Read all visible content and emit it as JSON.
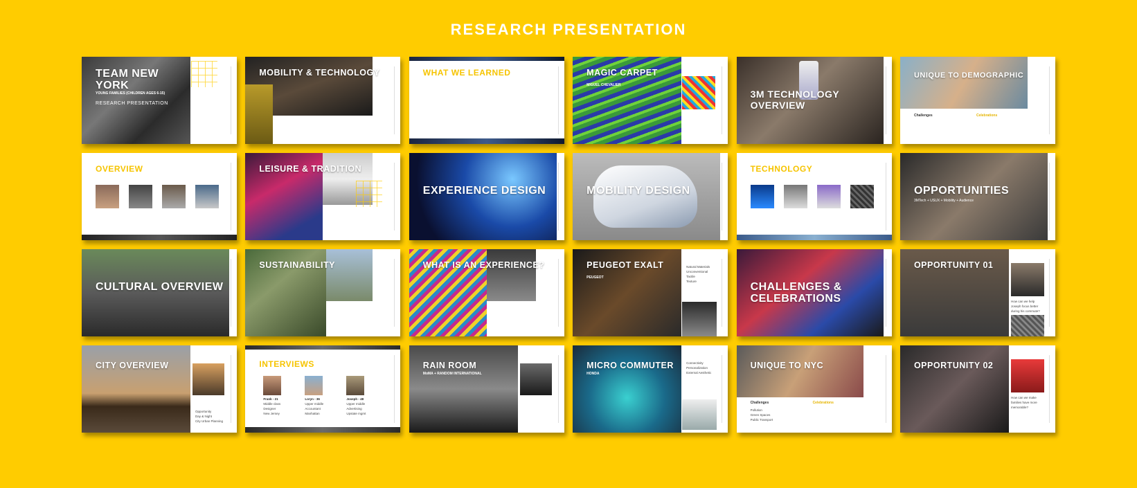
{
  "page": {
    "title": "RESEARCH PRESENTATION"
  },
  "slides": [
    {
      "title": "TEAM NEW YORK",
      "subtitle": "YOUNG FAMILIES (CHILDREN AGES 6-15)",
      "tagline": "RESEARCH PRESENTATION"
    },
    {
      "title": "MOBILITY & TECHNOLOGY"
    },
    {
      "title": "WHAT WE LEARNED"
    },
    {
      "title": "MAGIC CARPET",
      "subtitle": "MIGUEL CHEVALIER"
    },
    {
      "title": "3M TECHNOLOGY OVERVIEW"
    },
    {
      "title": "UNIQUE TO DEMOGRAPHIC",
      "col1": "Challenges",
      "col2": "Celebrations"
    },
    {
      "title": "OVERVIEW"
    },
    {
      "title": "LEISURE & TRADITION"
    },
    {
      "title": "EXPERIENCE DESIGN"
    },
    {
      "title": "MOBILITY DESIGN"
    },
    {
      "title": "TECHNOLOGY"
    },
    {
      "title": "OPPORTUNITIES",
      "subtitle": "3MTech + USUX + Mobility + Audience"
    },
    {
      "title": "CULTURAL OVERVIEW"
    },
    {
      "title": "SUSTAINABILITY"
    },
    {
      "title": "WHAT IS AN EXPERIENCE?"
    },
    {
      "title": "PEUGEOT EXALT",
      "subtitle": "PEUGEOT",
      "notes": [
        "Natural Materials",
        "Unconventional",
        "Tactile",
        "Texture"
      ]
    },
    {
      "title": "CHALLENGES & CELEBRATIONS"
    },
    {
      "title": "OPPORTUNITY 01",
      "question": "How can we help Joseph focus better during his commute?"
    },
    {
      "title": "CITY OVERVIEW",
      "notes": [
        "Opportunity",
        "Day & Night",
        "City Urban Planning"
      ]
    },
    {
      "title": "INTERVIEWS",
      "people": [
        {
          "name": "Frank - 21",
          "lines": [
            "Middle class",
            "Designer",
            "New Jersey"
          ]
        },
        {
          "name": "Loryn - 36",
          "lines": [
            "Upper middle",
            "Accountant",
            "Manhattan"
          ]
        },
        {
          "name": "Joseph - 48",
          "lines": [
            "Upper middle",
            "Advertising",
            "Upstate mgmt"
          ]
        }
      ]
    },
    {
      "title": "RAIN ROOM",
      "subtitle": "MoMA + RANDOM INTERNATIONAL"
    },
    {
      "title": "MICRO COMMUTER",
      "subtitle": "HONDA",
      "notes": [
        "Connectivity",
        "Personalization",
        "External Aesthetic"
      ]
    },
    {
      "title": "UNIQUE TO NYC",
      "col1": "Challenges",
      "col2": "Celebrations",
      "rows": [
        "Pollution",
        "Green Spaces",
        "Public Transport"
      ]
    },
    {
      "title": "OPPORTUNITY 02",
      "question": "How can we make families have more memorable?"
    }
  ],
  "colors": {
    "background": "#FFCC00",
    "accent": "#F6C400",
    "text_light": "#FFFFFF"
  }
}
